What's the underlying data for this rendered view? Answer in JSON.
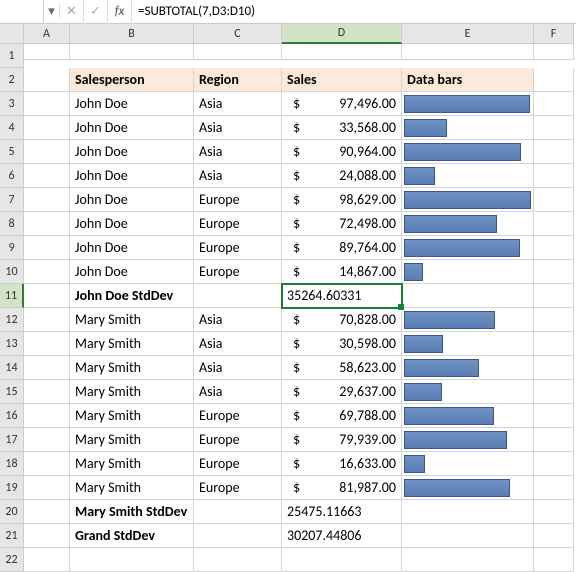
{
  "formula_bar": {
    "name_box": "",
    "dropdown_glyph": "▾",
    "cancel_glyph": "✕",
    "confirm_glyph": "✓",
    "fx_glyph": "fx",
    "formula": "=SUBTOTAL(7,D3:D10)"
  },
  "columns": [
    "A",
    "B",
    "C",
    "D",
    "E",
    "F"
  ],
  "selected_col_index": 3,
  "selected_row": 11,
  "headers": {
    "salesperson": "Salesperson",
    "region": "Region",
    "sales": "Sales",
    "databars": "Data bars"
  },
  "currency_symbol": "$",
  "max_value": 98629,
  "rows": [
    {
      "r": 3,
      "sp": "John Doe",
      "rg": "Asia",
      "val": "97,496.00",
      "num": 97496
    },
    {
      "r": 4,
      "sp": "John Doe",
      "rg": "Asia",
      "val": "33,568.00",
      "num": 33568
    },
    {
      "r": 5,
      "sp": "John Doe",
      "rg": "Asia",
      "val": "90,964.00",
      "num": 90964
    },
    {
      "r": 6,
      "sp": "John Doe",
      "rg": "Asia",
      "val": "24,088.00",
      "num": 24088
    },
    {
      "r": 7,
      "sp": "John Doe",
      "rg": "Europe",
      "val": "98,629.00",
      "num": 98629
    },
    {
      "r": 8,
      "sp": "John Doe",
      "rg": "Europe",
      "val": "72,498.00",
      "num": 72498
    },
    {
      "r": 9,
      "sp": "John Doe",
      "rg": "Europe",
      "val": "89,764.00",
      "num": 89764
    },
    {
      "r": 10,
      "sp": "John Doe",
      "rg": "Europe",
      "val": "14,867.00",
      "num": 14867
    }
  ],
  "stddev1": {
    "r": 11,
    "label": "John Doe StdDev",
    "val": "35264.60331"
  },
  "rows2": [
    {
      "r": 12,
      "sp": "Mary Smith",
      "rg": "Asia",
      "val": "70,828.00",
      "num": 70828
    },
    {
      "r": 13,
      "sp": "Mary Smith",
      "rg": "Asia",
      "val": "30,598.00",
      "num": 30598
    },
    {
      "r": 14,
      "sp": "Mary Smith",
      "rg": "Asia",
      "val": "58,623.00",
      "num": 58623
    },
    {
      "r": 15,
      "sp": "Mary Smith",
      "rg": "Asia",
      "val": "29,637.00",
      "num": 29637
    },
    {
      "r": 16,
      "sp": "Mary Smith",
      "rg": "Europe",
      "val": "69,788.00",
      "num": 69788
    },
    {
      "r": 17,
      "sp": "Mary Smith",
      "rg": "Europe",
      "val": "79,939.00",
      "num": 79939
    },
    {
      "r": 18,
      "sp": "Mary Smith",
      "rg": "Europe",
      "val": "16,633.00",
      "num": 16633
    },
    {
      "r": 19,
      "sp": "Mary Smith",
      "rg": "Europe",
      "val": "81,987.00",
      "num": 81987
    }
  ],
  "stddev2": {
    "r": 20,
    "label": "Mary Smith StdDev",
    "val": "25475.11663"
  },
  "grand": {
    "r": 21,
    "label": "Grand StdDev",
    "val": "30207.44806"
  },
  "blank_rows": [
    22
  ]
}
